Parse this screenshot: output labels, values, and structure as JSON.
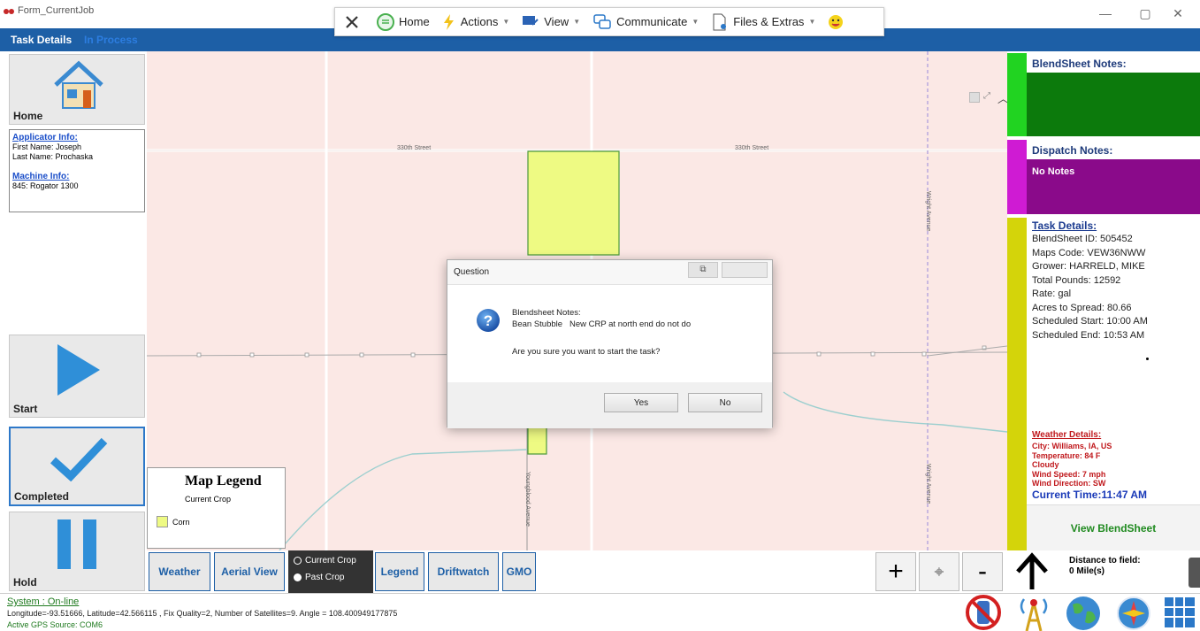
{
  "window": {
    "title": "Form_CurrentJob"
  },
  "toolbar": {
    "home_label": "Home",
    "actions_label": "Actions",
    "view_label": "View",
    "communicate_label": "Communicate",
    "files_label": "Files & Extras"
  },
  "header": {
    "title": "Task Details",
    "status": "In Process"
  },
  "left": {
    "home_label": "Home",
    "applicator_heading": "Applicator Info:",
    "first_name": "First Name: Joseph",
    "last_name": "Last Name: Prochaska",
    "machine_heading": "Machine Info:",
    "machine": "845: Rogator 1300",
    "start_label": "Start",
    "completed_label": "Completed",
    "hold_label": "Hold"
  },
  "map": {
    "road_labels": {
      "street_a": "330th Street",
      "street_b": "330th Street",
      "wright_top": "Wright Avenue",
      "wright_bottom": "Wright Avenue",
      "youngblood": "Youngblood Avenue"
    },
    "colors": {
      "background": "#fbe8e5",
      "field": "#eefa83"
    }
  },
  "legend": {
    "title": "Map Legend",
    "subtitle": "Current Crop",
    "items": [
      {
        "label": "Corn",
        "color": "#eefa83"
      }
    ]
  },
  "bottom_bar": {
    "weather": "Weather",
    "aerial": "Aerial View",
    "current_crop": "Current Crop",
    "past_crop": "Past Crop",
    "legend": "Legend",
    "driftwatch": "Driftwatch",
    "gmo": "GMO",
    "zoom_in": "+",
    "zoom_out": "-"
  },
  "right": {
    "blendsheet_notes_title": "BlendSheet Notes:",
    "dispatch_notes_title": "Dispatch Notes:",
    "dispatch_notes_text": "No Notes",
    "task_details_title": "Task Details:",
    "task_lines": [
      "BlendSheet ID: 505452",
      "Maps Code: VEW36NWW",
      "Grower: HARRELD, MIKE",
      "Total Pounds: 12592",
      "Rate: gal",
      "Acres to Spread: 80.66",
      "Scheduled Start: 10:00 AM",
      "Scheduled End: 10:53 AM"
    ],
    "weather_title": "Weather Details:",
    "weather_lines": [
      "City: Williams, IA, US",
      "Temperature: 84 F",
      "Cloudy",
      "Wind Speed: 7 mph",
      "Wind Direction: SW"
    ],
    "current_time": "Current Time:11:47 AM",
    "view_blendsheet": "View BlendSheet",
    "distance_title": "Distance to field:",
    "distance_value": "0 Mile(s)",
    "colors": {
      "blendsheet": "#0c7a0c",
      "blend_strip": "#21d321",
      "dispatch": "#8a0a8a",
      "dispatch_strip": "#cf1bd3",
      "task_strip": "#d4d40a"
    }
  },
  "status": {
    "system": "System : On-line",
    "gps": "Longitude=-93.51666, Latitude=42.566115 , Fix Quality=2, Number of Satellites=9.  Angle = 108.400949177875",
    "source": "Active GPS Source: COM6"
  },
  "dialog": {
    "title": "Question",
    "notes_heading": "Blendsheet Notes:",
    "notes_text": "Bean Stubble   New CRP at north end do not do",
    "question": "Are you sure you want to start the task?",
    "yes": "Yes",
    "no": "No"
  }
}
